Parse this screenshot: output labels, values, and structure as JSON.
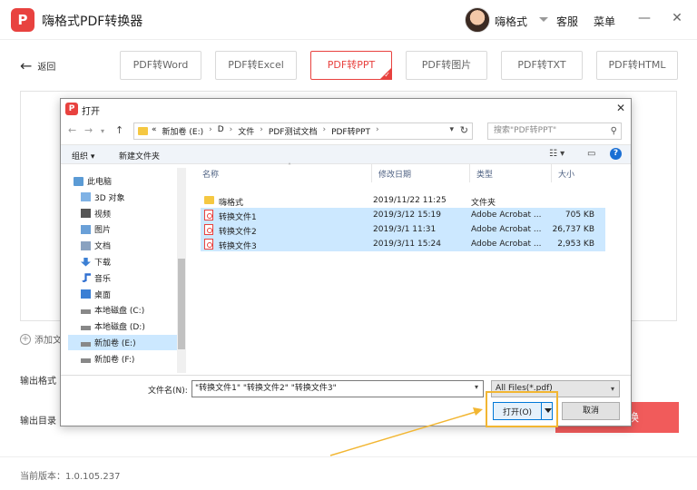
{
  "app": {
    "title": "嗨格式PDF转换器",
    "logo_char": "P",
    "user_name": "嗨格式",
    "support_label": "客服",
    "menu_label": "菜单",
    "minimize_glyph": "—",
    "close_glyph": "✕"
  },
  "nav": {
    "back_label": "返回",
    "tabs": [
      {
        "label": "PDF转Word",
        "active": false
      },
      {
        "label": "PDF转Excel",
        "active": false
      },
      {
        "label": "PDF转PPT",
        "active": true
      },
      {
        "label": "PDF转图片",
        "active": false
      },
      {
        "label": "PDF转TXT",
        "active": false
      },
      {
        "label": "PDF转HTML",
        "active": false
      }
    ]
  },
  "main": {
    "add_file_label": "添加文",
    "output_format_label": "输出格式",
    "output_dir_label": "输出目录",
    "convert_label": "换",
    "version_text": "当前版本：1.0.105.237"
  },
  "dialog": {
    "title": "打开",
    "path": [
      "«",
      "新加卷 (E:)",
      "D",
      "文件",
      "PDF测试文档",
      "PDF转PPT"
    ],
    "search_placeholder": "搜索\"PDF转PPT\"",
    "organize_label": "组织 ▾",
    "new_folder_label": "新建文件夹",
    "nav_items": [
      {
        "label": "此电脑",
        "icon": "computer-icon",
        "selected": false,
        "indent": 0
      },
      {
        "label": "3D 对象",
        "icon": "cube-icon",
        "selected": false,
        "indent": 1
      },
      {
        "label": "视频",
        "icon": "video-icon",
        "selected": false,
        "indent": 1
      },
      {
        "label": "图片",
        "icon": "picture-icon",
        "selected": false,
        "indent": 1
      },
      {
        "label": "文档",
        "icon": "document-icon",
        "selected": false,
        "indent": 1
      },
      {
        "label": "下载",
        "icon": "download-icon",
        "selected": false,
        "indent": 1
      },
      {
        "label": "音乐",
        "icon": "music-icon",
        "selected": false,
        "indent": 1
      },
      {
        "label": "桌面",
        "icon": "desktop-icon",
        "selected": false,
        "indent": 1
      },
      {
        "label": "本地磁盘 (C:)",
        "icon": "drive-icon",
        "selected": false,
        "indent": 1
      },
      {
        "label": "本地磁盘 (D:)",
        "icon": "drive-icon",
        "selected": false,
        "indent": 1
      },
      {
        "label": "新加卷 (E:)",
        "icon": "drive-icon",
        "selected": true,
        "indent": 1
      },
      {
        "label": "新加卷 (F:)",
        "icon": "drive-icon",
        "selected": false,
        "indent": 1
      }
    ],
    "columns": {
      "name": "名称",
      "modified": "修改日期",
      "type": "类型",
      "size": "大小"
    },
    "files": [
      {
        "name": "嗨格式",
        "modified": "2019/11/22 11:25",
        "type": "文件夹",
        "size": "",
        "kind": "folder",
        "selected": false
      },
      {
        "name": "转换文件1",
        "modified": "2019/3/12 15:19",
        "type": "Adobe Acrobat ...",
        "size": "705 KB",
        "kind": "pdf",
        "selected": true
      },
      {
        "name": "转换文件2",
        "modified": "2019/3/1 11:31",
        "type": "Adobe Acrobat ...",
        "size": "26,737 KB",
        "kind": "pdf",
        "selected": true
      },
      {
        "name": "转换文件3",
        "modified": "2019/3/11 15:24",
        "type": "Adobe Acrobat ...",
        "size": "2,953 KB",
        "kind": "pdf",
        "selected": true
      }
    ],
    "filename_label": "文件名(N):",
    "filename_value": "\"转换文件1\" \"转换文件2\" \"转换文件3\"",
    "filter_value": "All Files(*.pdf)",
    "open_label": "打开(O)",
    "cancel_label": "取消"
  },
  "colors": {
    "accent": "#e8423f",
    "highlight": "#f2b632",
    "selection": "#cce8ff"
  }
}
